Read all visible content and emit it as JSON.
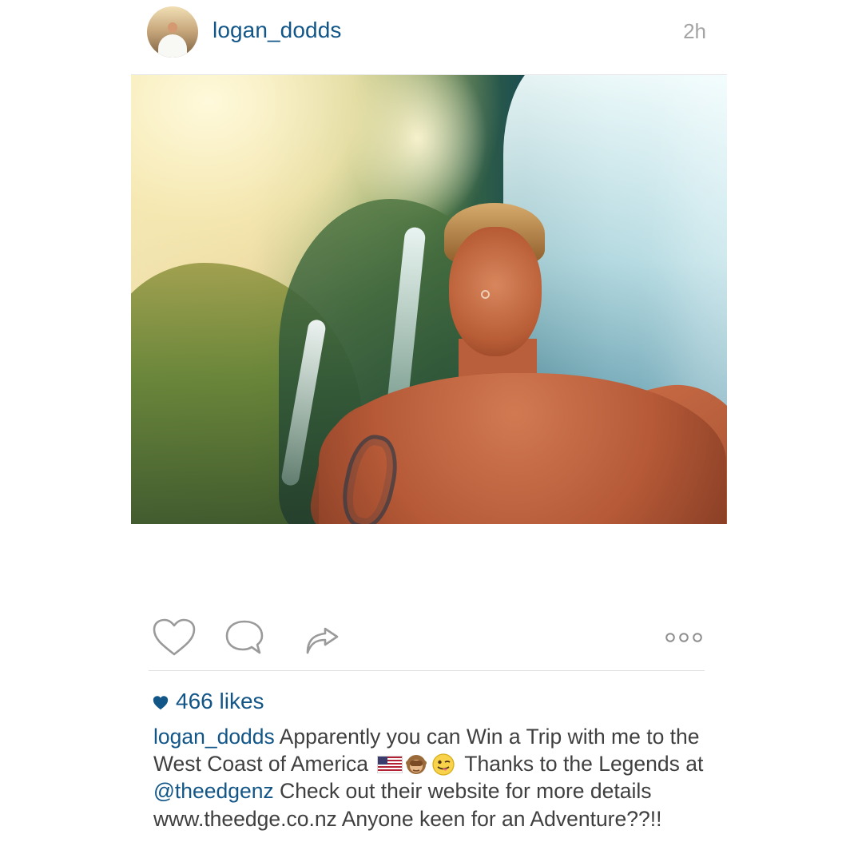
{
  "header": {
    "username": "logan_dodds",
    "timestamp": "2h"
  },
  "actions": {
    "like_icon": "heart-outline-icon",
    "comment_icon": "comment-bubble-icon",
    "share_icon": "share-arrow-icon",
    "more_icon": "more-options-icon"
  },
  "stats": {
    "likes": "466 likes",
    "like_icon": "heart-filled-icon"
  },
  "caption": {
    "username": "logan_dodds",
    "text_1": " Apparently you can Win a Trip with me to the West Coast of America ",
    "emoji_names": [
      "us-flag-emoji",
      "see-no-evil-monkey-emoji",
      "winking-face-with-tongue-emoji"
    ],
    "text_2": " Thanks to the Legends at ",
    "mention": "@theedgenz",
    "text_3": " Check out their website for more details www.theedge.co.nz Anyone keen for an Adventure??!!"
  },
  "colors": {
    "link": "#125688",
    "text": "#3f3f3f",
    "time": "#a4a4a4",
    "divider": "#dedede"
  }
}
